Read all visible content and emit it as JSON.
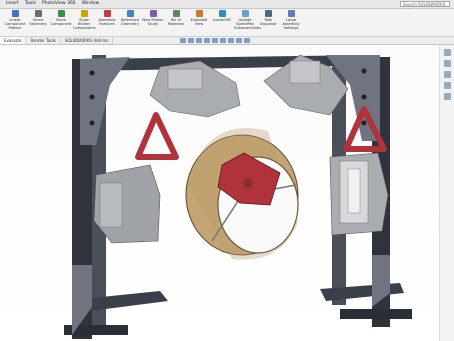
{
  "menu": [
    "Insert",
    "Tools",
    "PhotoView 360",
    "Window"
  ],
  "search": {
    "placeholder": "Search SOLIDWORKS Help"
  },
  "ribbon": [
    {
      "label": "Linear Component Pattern",
      "icon": "pattern-icon",
      "color": "#3b76c4"
    },
    {
      "label": "Smart Fasteners",
      "icon": "fastener-icon",
      "color": "#6b6b6b"
    },
    {
      "label": "Move Component",
      "icon": "move-icon",
      "color": "#3f8f3f"
    },
    {
      "label": "Show Hidden Components",
      "icon": "show-hidden-icon",
      "color": "#d6a000"
    },
    {
      "label": "Assembly Features",
      "icon": "assembly-features-icon",
      "color": "#c04040"
    },
    {
      "label": "Reference Geometry",
      "icon": "reference-geometry-icon",
      "color": "#4a7fc1"
    },
    {
      "label": "New Motion Study",
      "icon": "motion-study-icon",
      "color": "#7a5db5"
    },
    {
      "label": "Bill of Materials",
      "icon": "bom-icon",
      "color": "#5a8a5a"
    },
    {
      "label": "Exploded View",
      "icon": "exploded-view-icon",
      "color": "#c77a2a"
    },
    {
      "label": "Instant3D",
      "icon": "instant3d-icon",
      "color": "#2a8fbf"
    },
    {
      "label": "Update SpeedPak Subassemblies",
      "icon": "speedpak-icon",
      "color": "#6aa0d0"
    },
    {
      "label": "Take Snapshot",
      "icon": "snapshot-icon",
      "color": "#4a6a8a"
    },
    {
      "label": "Large Assembly Settings",
      "icon": "large-assembly-icon",
      "color": "#5a7fb0"
    }
  ],
  "tabs": [
    "Evaluate",
    "Render Tools",
    "SOLIDWORKS Add-Ins"
  ],
  "active_tab": 0,
  "colors": {
    "frame": "#3a3f4a",
    "bracket_red": "#b0323a",
    "cylinder": "#b99a6a",
    "gray_part": "#a9acb0"
  }
}
